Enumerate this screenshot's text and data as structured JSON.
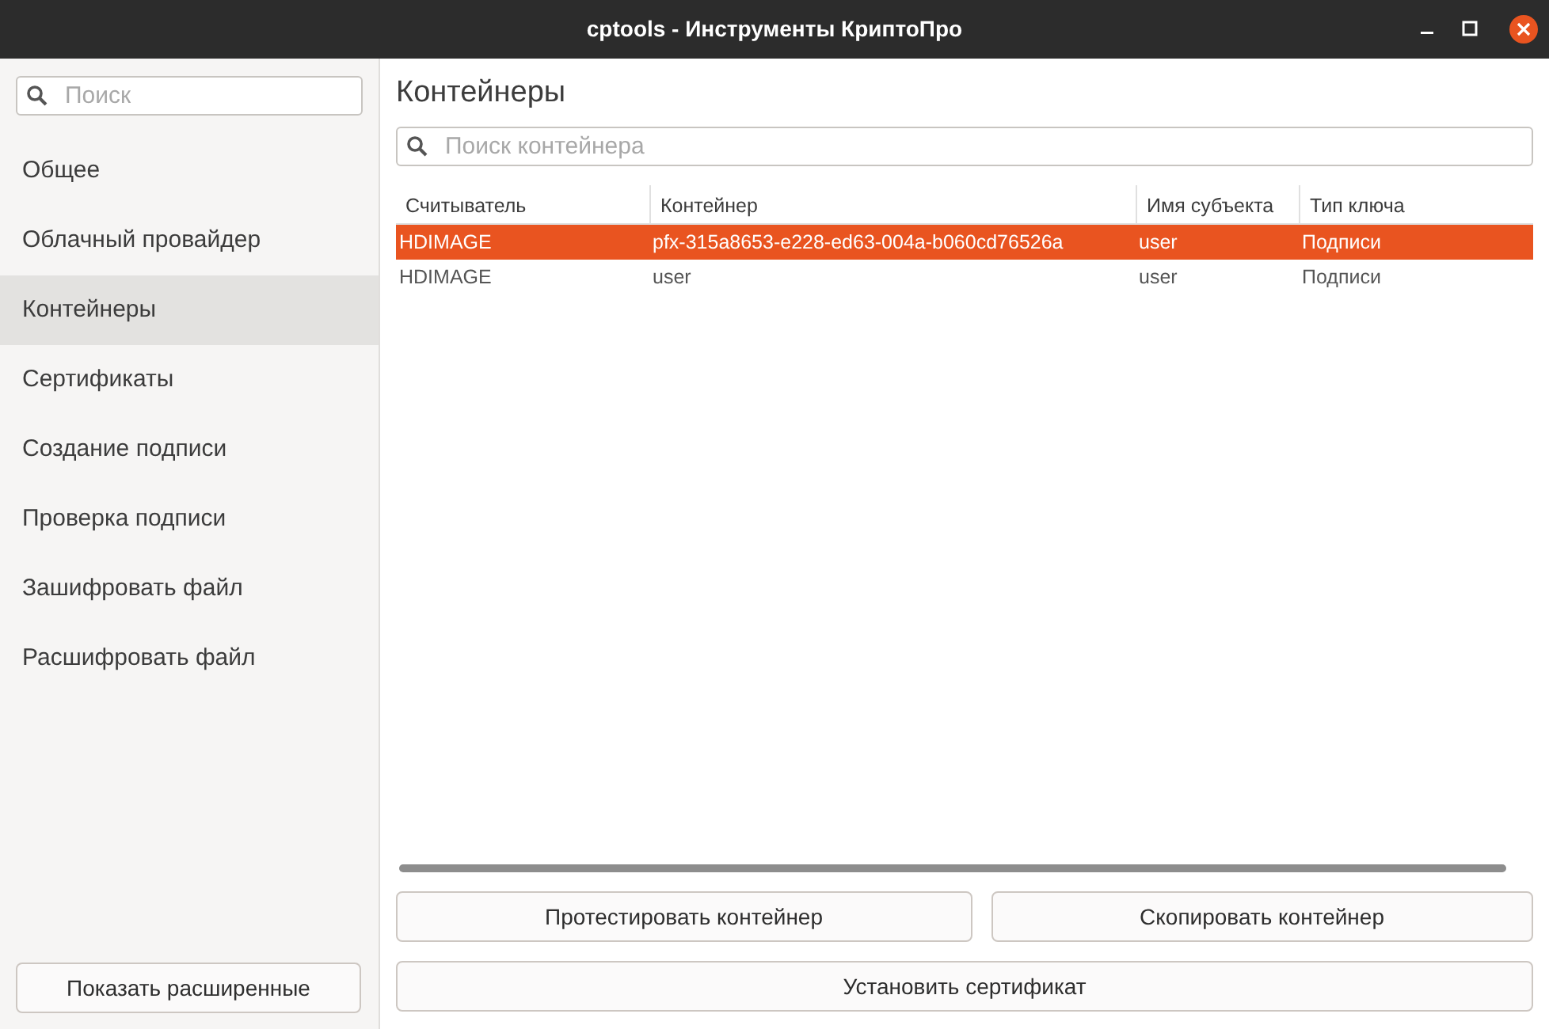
{
  "window": {
    "title": "cptools - Инструменты КриптоПро"
  },
  "sidebar": {
    "search": {
      "placeholder": "Поиск"
    },
    "items": [
      {
        "label": "Общее",
        "selected": false
      },
      {
        "label": "Облачный провайдер",
        "selected": false
      },
      {
        "label": "Контейнеры",
        "selected": true
      },
      {
        "label": "Сертификаты",
        "selected": false
      },
      {
        "label": "Создание подписи",
        "selected": false
      },
      {
        "label": "Проверка подписи",
        "selected": false
      },
      {
        "label": "Зашифровать файл",
        "selected": false
      },
      {
        "label": "Расшифровать файл",
        "selected": false
      }
    ],
    "button": "Показать расширенные"
  },
  "main": {
    "heading": "Контейнеры",
    "search": {
      "placeholder": "Поиск контейнера"
    },
    "table": {
      "columns": [
        "Считыватель",
        "Контейнер",
        "Имя субъекта",
        "Тип ключа"
      ],
      "rows": [
        {
          "cells": [
            "HDIMAGE",
            "pfx-315a8653-e228-ed63-004a-b060cd76526a",
            "user",
            "Подписи"
          ],
          "selected": true
        },
        {
          "cells": [
            "HDIMAGE",
            "user",
            "user",
            "Подписи"
          ],
          "selected": false
        }
      ]
    },
    "buttons": [
      [
        "Протестировать контейнер",
        "Скопировать контейнер"
      ],
      [
        "Установить сертификат"
      ]
    ]
  }
}
